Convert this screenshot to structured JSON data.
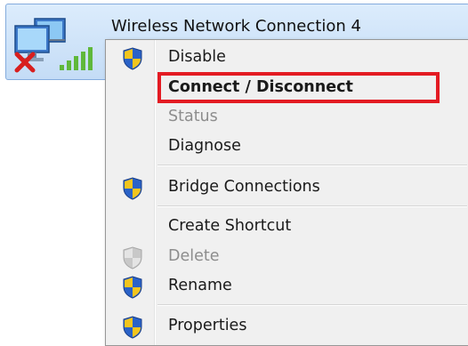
{
  "connection": {
    "title": "Wireless Network Connection 4"
  },
  "menu": {
    "items": [
      {
        "label": "Disable"
      },
      {
        "label": "Connect / Disconnect"
      },
      {
        "label": "Status"
      },
      {
        "label": "Diagnose"
      },
      {
        "label": "Bridge Connections"
      },
      {
        "label": "Create Shortcut"
      },
      {
        "label": "Delete"
      },
      {
        "label": "Rename"
      },
      {
        "label": "Properties"
      }
    ]
  },
  "colors": {
    "highlight": "#e31b23",
    "shield_blue": "#2a62c8",
    "shield_yellow": "#f3c51d"
  },
  "icons": [
    "network-adapter-icon",
    "disconnected-x-icon",
    "signal-bars-icon",
    "uac-shield-icon"
  ]
}
